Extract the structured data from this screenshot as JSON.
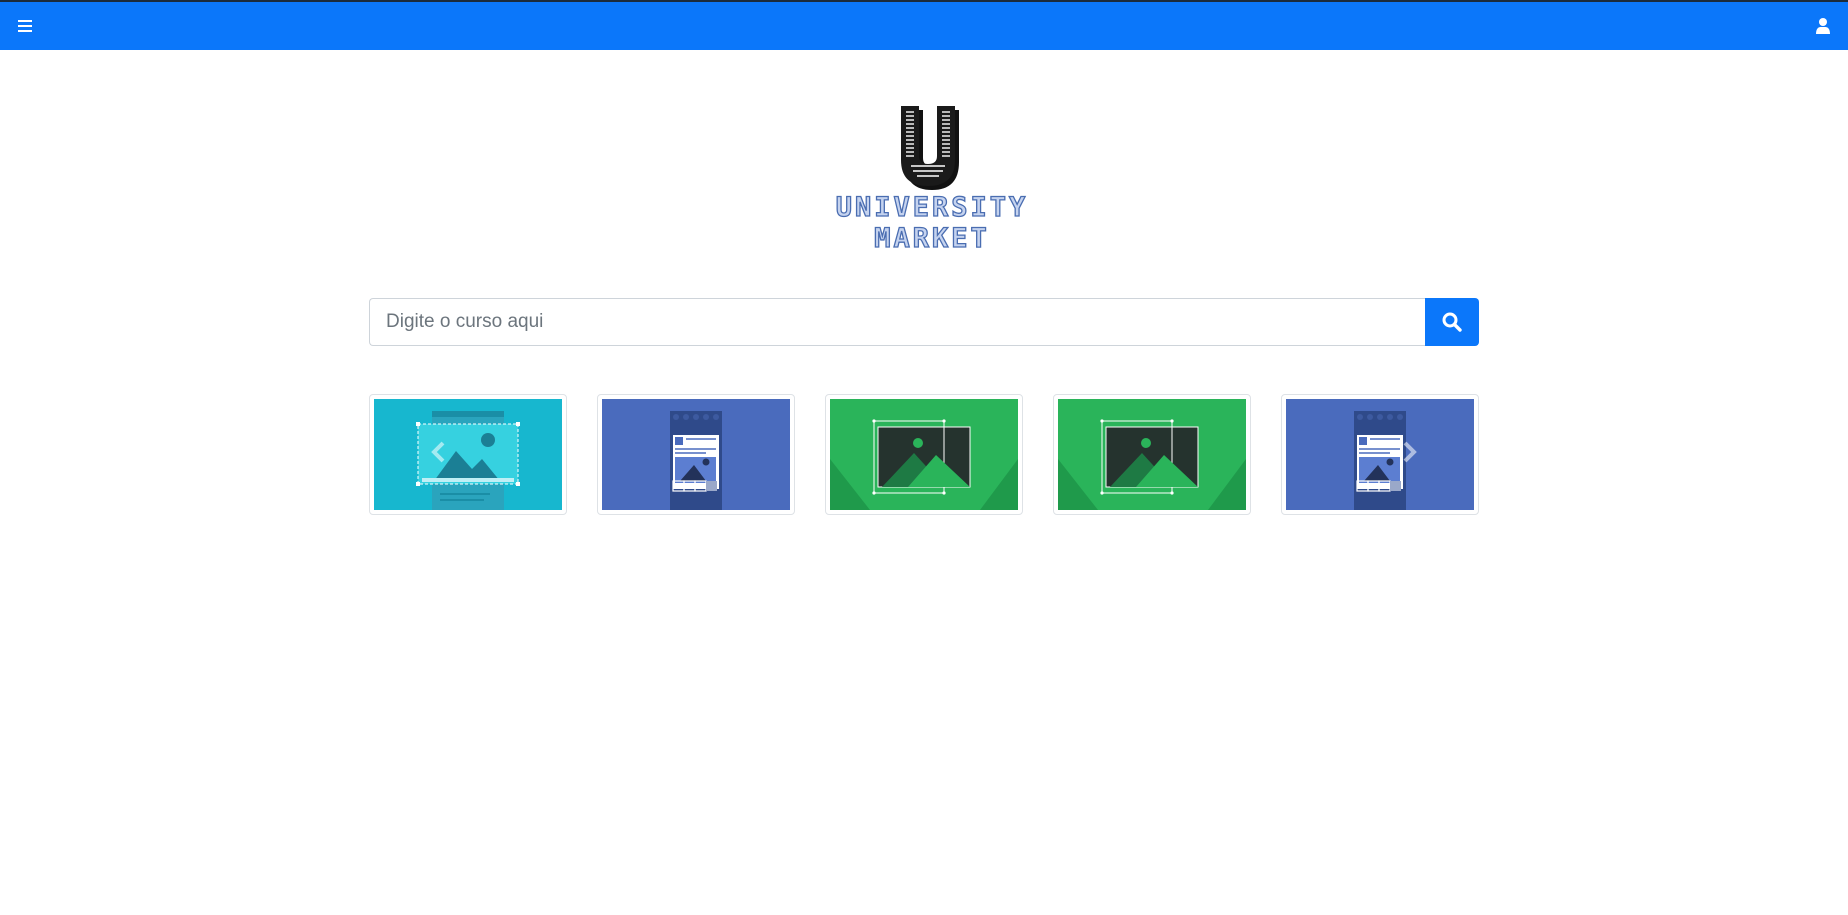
{
  "header": {
    "menu_icon": "hamburger-menu-icon",
    "user_icon": "user-icon",
    "accent_color": "#0b77fa"
  },
  "logo": {
    "text": "UNIVERSITY MARKET",
    "icon": "u-letter-logo"
  },
  "search": {
    "placeholder": "Digite o curso aqui",
    "value": "",
    "button_icon": "search-icon"
  },
  "carousel": {
    "prev_icon": "chevron-left-icon",
    "next_icon": "chevron-right-icon",
    "items": [
      {
        "image": "image-editor-placeholder",
        "color": "#17b7cf"
      },
      {
        "image": "mobile-layout-placeholder",
        "color": "#4a6bbd"
      },
      {
        "image": "landscape-crop-placeholder",
        "color": "#2ab45a"
      },
      {
        "image": "landscape-crop-placeholder",
        "color": "#2ab45a"
      },
      {
        "image": "mobile-layout-placeholder",
        "color": "#4a6bbd"
      }
    ]
  }
}
